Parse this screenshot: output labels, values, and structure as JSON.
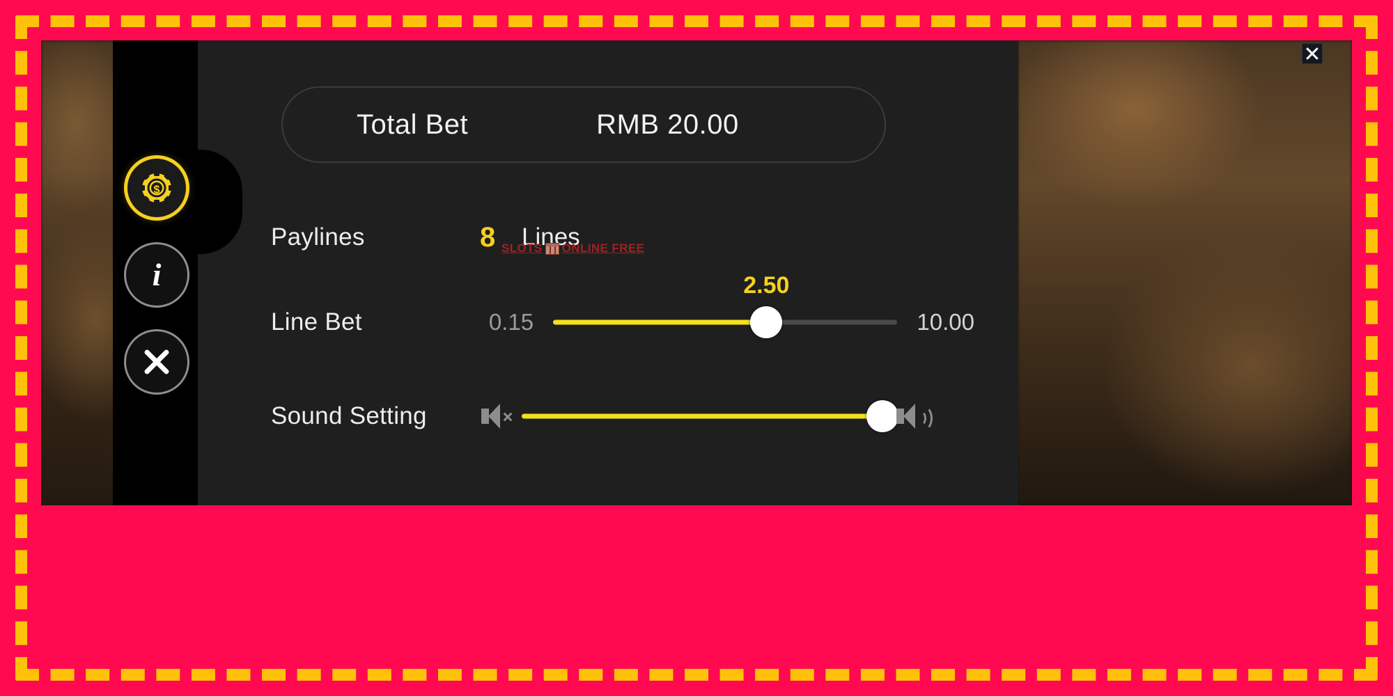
{
  "window": {
    "close_button_icon": "close-icon"
  },
  "sidebar": {
    "items": [
      {
        "id": "bet-settings",
        "icon": "casino-chip-icon",
        "active": true
      },
      {
        "id": "game-info",
        "icon": "info-icon",
        "active": false
      },
      {
        "id": "close-panel",
        "icon": "close-icon",
        "active": false
      }
    ]
  },
  "total_bet": {
    "label": "Total Bet",
    "value": "RMB 20.00"
  },
  "paylines": {
    "label": "Paylines",
    "count": "8",
    "unit": "Lines"
  },
  "line_bet": {
    "label": "Line Bet",
    "min": "0.15",
    "max": "10.00",
    "current": "2.50",
    "percent": 62
  },
  "sound": {
    "label": "Sound Setting",
    "mute_icon": "speaker-mute-icon",
    "max_icon": "speaker-loud-icon",
    "percent": 100
  },
  "watermark": {
    "text_left": "SLOTS",
    "text_right": "ONLINE FREE",
    "icon": "slot-machine-icon"
  },
  "colors": {
    "accent_yellow": "#f5d020",
    "slider_yellow": "#f2e11e",
    "panel_bg": "#1f1f1f",
    "frame_pink": "#ff0a50",
    "frame_dash": "#ffc20a",
    "watermark_red": "#9e2222"
  }
}
